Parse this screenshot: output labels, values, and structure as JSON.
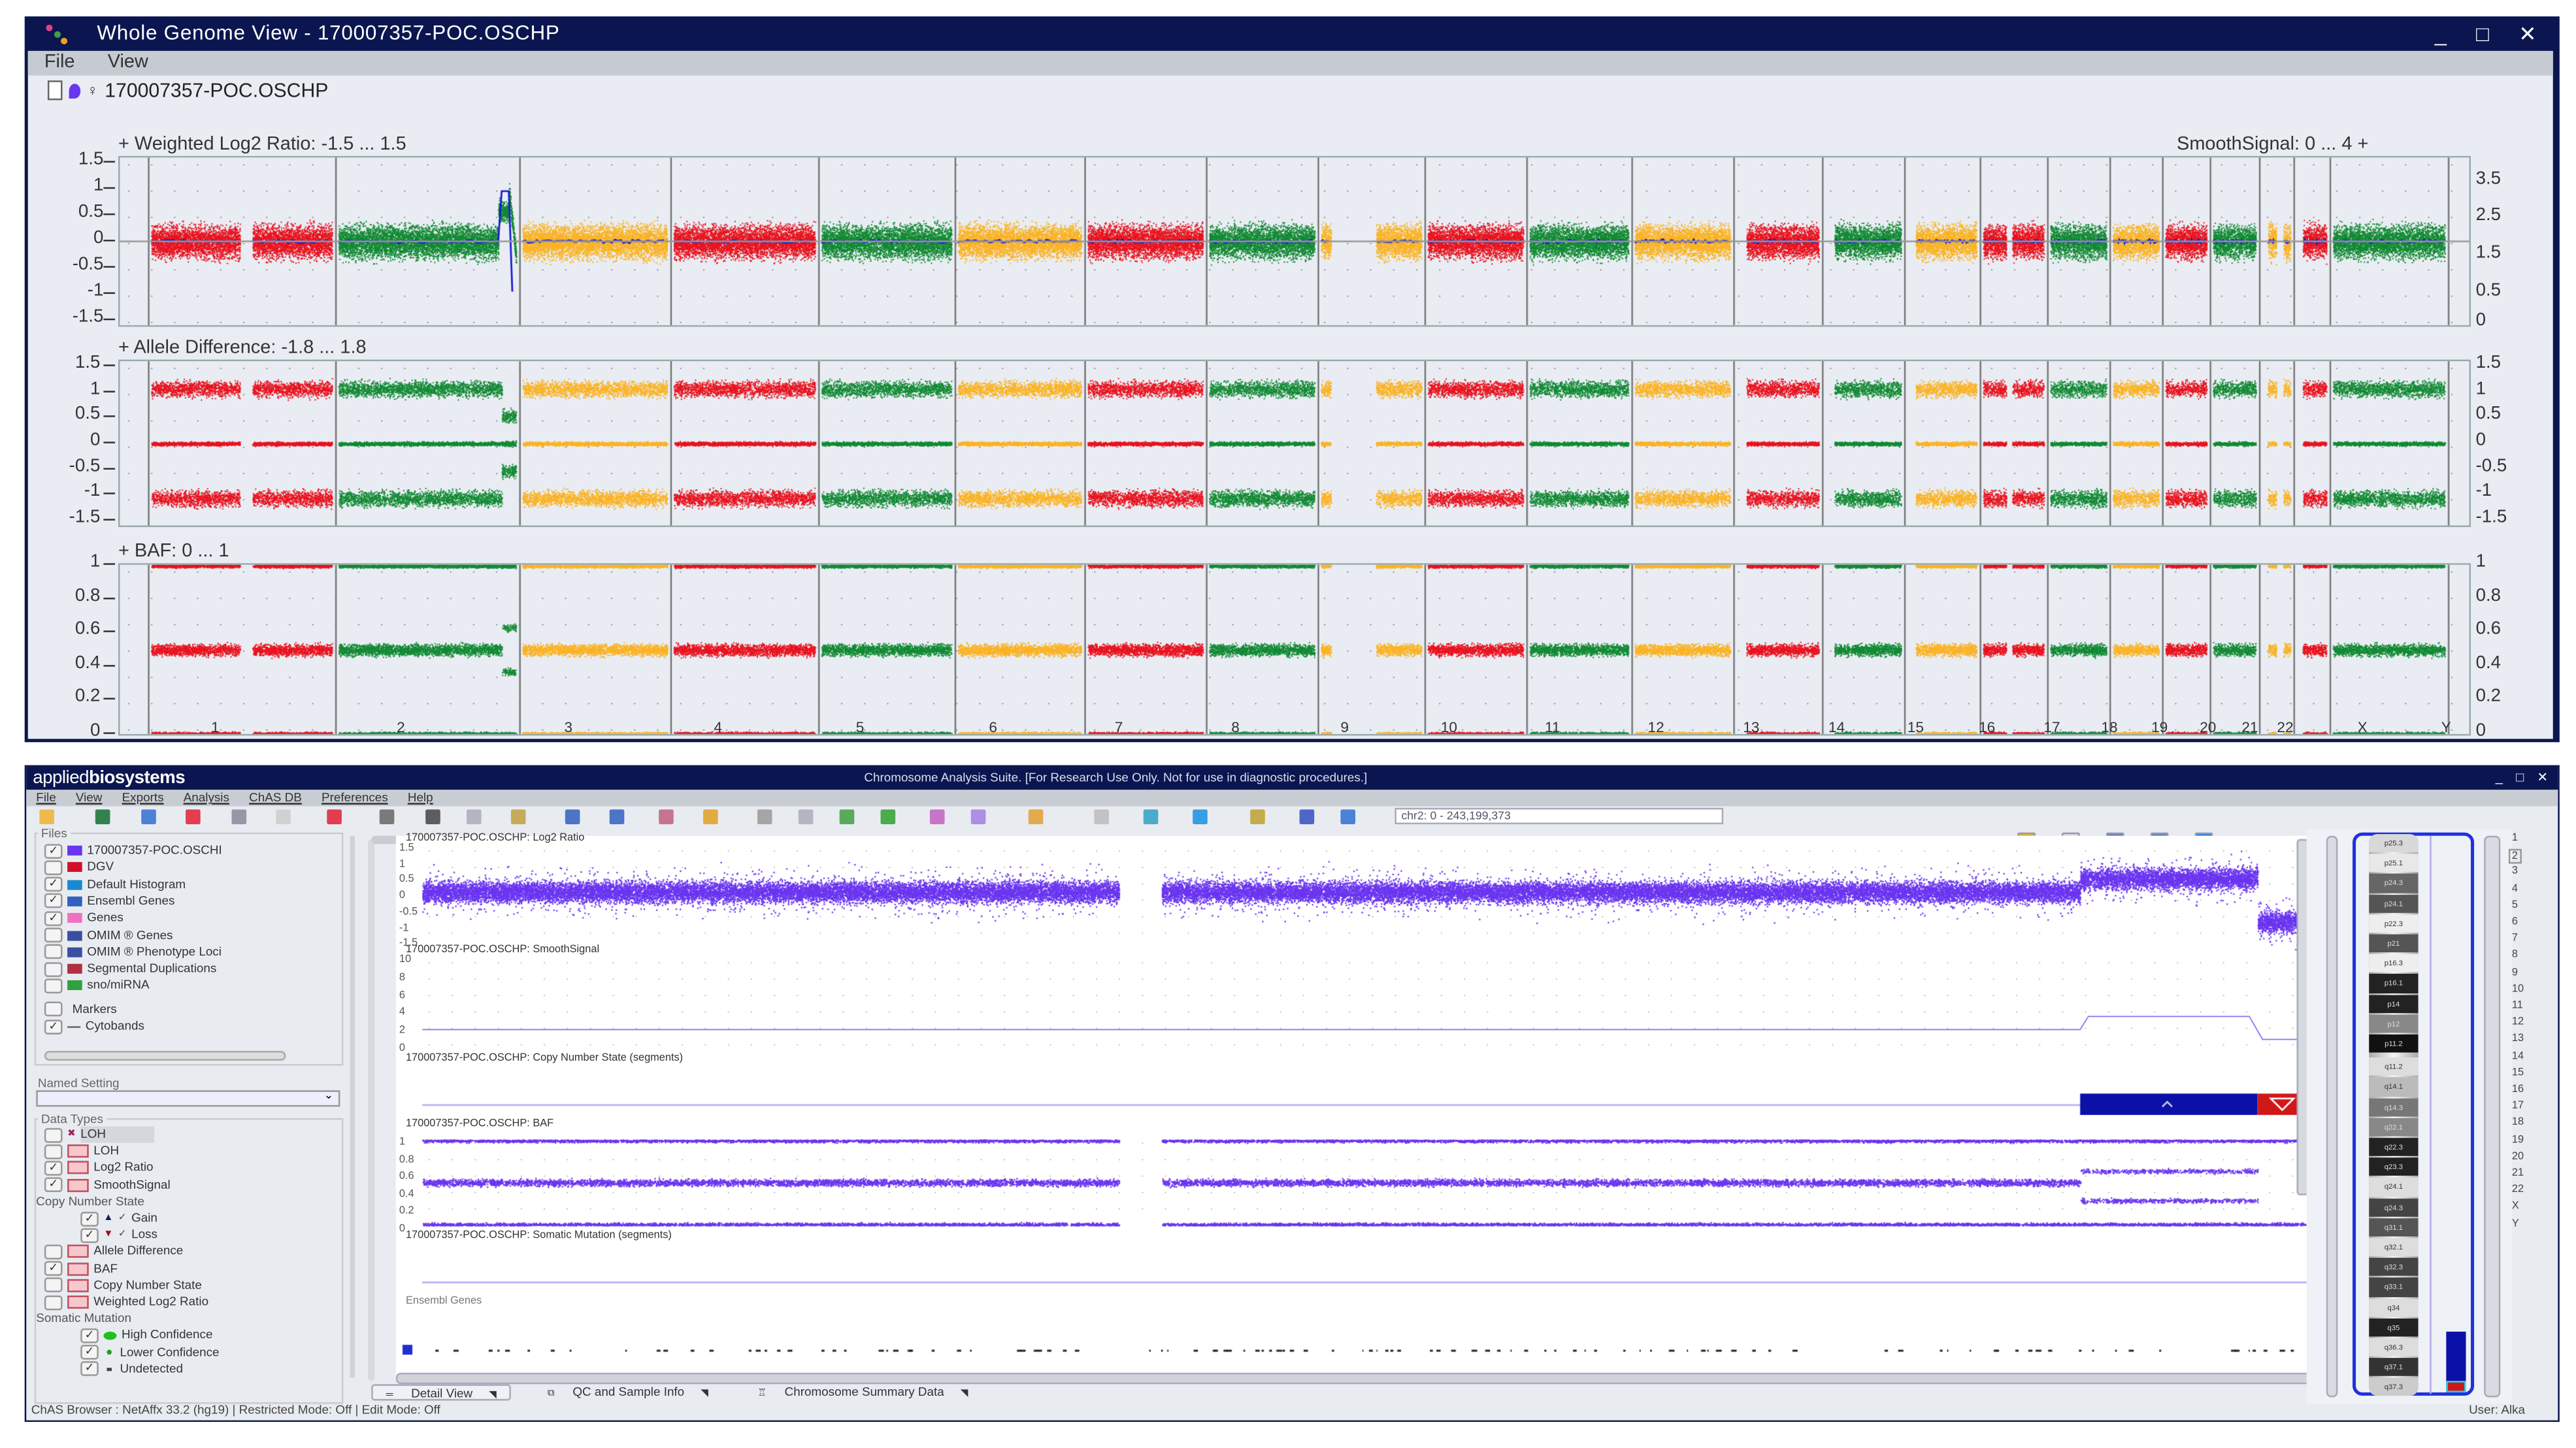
{
  "whole_genome_window": {
    "title": "Whole Genome View - 170007357-POC.OSCHP",
    "menu": [
      "File",
      "View"
    ],
    "file_name": "170007357-POC.OSCHP",
    "panels": [
      {
        "label": "+ Weighted Log2 Ratio: -1.5 ... 1.5",
        "right_label": "SmoothSignal: 0 ... 4  +",
        "left_ticks": [
          "1.5",
          "1",
          "0.5",
          "0",
          "-0.5",
          "-1",
          "-1.5"
        ],
        "right_ticks": [
          "3.5",
          "2.5",
          "1.5",
          "0.5",
          "0"
        ]
      },
      {
        "label": "+ Allele Difference: -1.8 ... 1.8",
        "left_ticks": [
          "1.5",
          "1",
          "0.5",
          "0",
          "-0.5",
          "-1",
          "-1.5"
        ],
        "right_ticks": [
          "1.5",
          "1",
          "0.5",
          "0",
          "-0.5",
          "-1",
          "-1.5"
        ]
      },
      {
        "label": "+ BAF: 0 ... 1",
        "left_ticks": [
          "1",
          "0.8",
          "0.6",
          "0.4",
          "0.2",
          "0"
        ],
        "right_ticks": [
          "1",
          "0.8",
          "0.6",
          "0.4",
          "0.2",
          "0"
        ]
      }
    ],
    "window_controls": [
      "_",
      "□",
      "✕"
    ]
  },
  "chart_data": {
    "type": "scatter",
    "chromosomes": [
      "1",
      "2",
      "3",
      "4",
      "5",
      "6",
      "7",
      "8",
      "9",
      "10",
      "11",
      "12",
      "13",
      "14",
      "15",
      "16",
      "17",
      "18",
      "19",
      "20",
      "21",
      "22",
      "X",
      "Y"
    ],
    "colors": {
      "red": "#e8131f",
      "green": "#128a34",
      "orange": "#fbb324",
      "smooth": "#1a1ad0",
      "detail": "#6a35f0"
    },
    "log2_ylim": [
      -1.5,
      1.5
    ],
    "allele_ylim": [
      -1.8,
      1.8
    ],
    "baf_ylim": [
      0,
      1
    ],
    "smooth_ylim": [
      0,
      4
    ]
  },
  "browser_window": {
    "brand": "applied",
    "brand_bold": "biosystems",
    "title": "Chromosome Analysis Suite. [For Research Use Only. Not for use in diagnostic procedures.]",
    "menu": [
      "File",
      "View",
      "Exports",
      "Analysis",
      "ChAS DB",
      "Preferences",
      "Help"
    ],
    "location": "chr2: 0 - 243,199,373",
    "files_label": "Files",
    "files": [
      {
        "label": "170007357-POC.OSCHI",
        "checked": true,
        "icon": "file-icon",
        "color": "#6a35f0"
      },
      {
        "label": "DGV",
        "checked": false,
        "icon": "dgv-icon",
        "color": "#d0102a"
      },
      {
        "label": "Default Histogram",
        "checked": true,
        "icon": "histogram-icon",
        "color": "#1a8ad0"
      },
      {
        "label": "Ensembl Genes",
        "checked": true,
        "icon": "ensembl-icon",
        "color": "#3060c0"
      },
      {
        "label": "Genes",
        "checked": true,
        "icon": "genes-icon",
        "color": "#f070c0"
      },
      {
        "label": "OMIM ® Genes",
        "checked": false,
        "icon": "omim-icon",
        "color": "#3a4fa0"
      },
      {
        "label": "OMIM ® Phenotype Loci",
        "checked": false,
        "icon": "omim-icon",
        "color": "#3a4fa0"
      },
      {
        "label": "Segmental Duplications",
        "checked": false,
        "icon": "segdup-icon",
        "color": "#b03040"
      },
      {
        "label": "sno/miRNA",
        "checked": false,
        "icon": "mirna-icon",
        "color": "#30a040"
      },
      {
        "label": "Markers",
        "checked": false,
        "icon": "",
        "color": ""
      },
      {
        "label": "Cytobands",
        "checked": true,
        "icon": "cytoband-icon",
        "color": "#888888"
      }
    ],
    "named_setting_label": "Named Setting",
    "named_setting_value": "",
    "data_types_label": "Data Types",
    "data_types": [
      {
        "label": "LOH",
        "checked": false,
        "indent": 0,
        "icon": "loh-x-icon",
        "highlight": true
      },
      {
        "label": "LOH",
        "checked": false,
        "indent": 0,
        "icon": "track-icon"
      },
      {
        "label": "Log2 Ratio",
        "checked": true,
        "indent": 0,
        "icon": "track-icon"
      },
      {
        "label": "SmoothSignal",
        "checked": true,
        "indent": 0,
        "icon": "track-icon"
      },
      {
        "label": "Copy Number State",
        "header": true
      },
      {
        "label": "Gain",
        "checked": true,
        "indent": 1,
        "icon": "gain-icon"
      },
      {
        "label": "Loss",
        "checked": true,
        "indent": 1,
        "icon": "loss-icon"
      },
      {
        "label": "Allele Difference",
        "checked": false,
        "indent": 0,
        "icon": "track-icon"
      },
      {
        "label": "BAF",
        "checked": true,
        "indent": 0,
        "icon": "track-icon"
      },
      {
        "label": "Copy Number State",
        "checked": false,
        "indent": 0,
        "icon": "track-icon"
      },
      {
        "label": "Weighted Log2 Ratio",
        "checked": false,
        "indent": 0,
        "icon": "track-icon"
      },
      {
        "label": "Somatic Mutation",
        "header": true
      },
      {
        "label": "High Confidence",
        "checked": true,
        "indent": 1,
        "icon": "high-confidence-icon"
      },
      {
        "label": "Lower Confidence",
        "checked": true,
        "indent": 1,
        "icon": "lower-confidence-icon"
      },
      {
        "label": "Undetected",
        "checked": true,
        "indent": 1,
        "icon": "undetected-icon"
      }
    ],
    "tracks": {
      "log2": {
        "label": "170007357-POC.OSCHP: Log2 Ratio",
        "ticks": [
          "1.5",
          "1",
          "0.5",
          "0",
          "-0.5",
          "-1",
          "-1.5"
        ]
      },
      "smooth": {
        "label": "170007357-POC.OSCHP: SmoothSignal",
        "ticks": [
          "10",
          "8",
          "6",
          "4",
          "2",
          "0"
        ]
      },
      "cn": {
        "label": "170007357-POC.OSCHP: Copy Number State (segments)"
      },
      "baf": {
        "label": "170007357-POC.OSCHP: BAF",
        "ticks": [
          "1",
          "0.8",
          "0.6",
          "0.4",
          "0.2",
          "0"
        ]
      },
      "somatic": {
        "label": "170007357-POC.OSCHP: Somatic Mutation (segments)"
      },
      "ensembl": {
        "label": "Ensembl Genes"
      }
    },
    "tabs": [
      "Detail View",
      "QC and Sample Info",
      "Chromosome Summary Data"
    ],
    "status": "ChAS Browser : NetAffx 33.2 (hg19) | Restricted Mode: Off | Edit Mode: Off",
    "user": "User: Alka",
    "cytobands": [
      "p25.3",
      "p25.1",
      "p24.3",
      "p24.1",
      "p22.3",
      "p21",
      "p16.3",
      "p16.1",
      "p14",
      "p12",
      "p11.2",
      "q11.2",
      "q14.1",
      "q14.3",
      "q22.1",
      "q22.3",
      "q23.3",
      "q24.1",
      "q24.3",
      "q31.1",
      "q32.1",
      "q32.3",
      "q33.1",
      "q34",
      "q35",
      "q36.3",
      "q37.1",
      "q37.3"
    ],
    "chromosome_list": [
      "1",
      "2",
      "3",
      "4",
      "5",
      "6",
      "7",
      "8",
      "9",
      "10",
      "11",
      "12",
      "13",
      "14",
      "15",
      "16",
      "17",
      "18",
      "19",
      "20",
      "21",
      "22",
      "X",
      "Y"
    ],
    "selected_chromosome": "2"
  }
}
